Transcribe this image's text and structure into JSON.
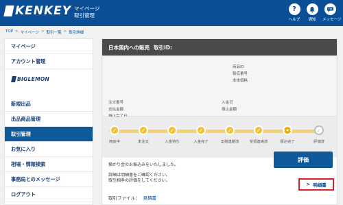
{
  "header": {
    "brand": "KENKEY",
    "subtitle_1": "マイページ",
    "subtitle_2": "取引管理",
    "icons": [
      {
        "name": "help-icon",
        "glyph": "?",
        "label": "ヘルプ"
      },
      {
        "name": "bell-icon",
        "glyph": "🔔",
        "label": "通知"
      },
      {
        "name": "chat-icon",
        "glyph": "💬",
        "label": "メッセージ"
      }
    ]
  },
  "breadcrumb": [
    "TOP",
    "マイページ",
    "取引一覧",
    "取引詳細"
  ],
  "sidebar": {
    "items": [
      {
        "label": "マイページ"
      },
      {
        "label": "アカウント管理"
      },
      {
        "label": "新規出品"
      },
      {
        "label": "出品商品管理"
      },
      {
        "label": "取引管理"
      },
      {
        "label": "お気に入り"
      },
      {
        "label": "相場・情報検索"
      },
      {
        "label": "事務局とのメッセージ"
      },
      {
        "label": "ログアウト"
      }
    ],
    "banner": "BIGLEMON"
  },
  "main": {
    "title": "日本国内への販売",
    "trade_id_label": "取引ID:",
    "info": {
      "product_id": "商品ID",
      "manufacturer_no": "製造番号",
      "body_price": "本体価格",
      "order_no": "注文番号",
      "payment_amount": "支払金額",
      "completion_date": "振込完了日",
      "deposit_date": "入金日",
      "transfer_amount": "振込金額"
    },
    "steps": [
      {
        "label": "商談中",
        "state": "done"
      },
      {
        "label": "未注文",
        "state": "done"
      },
      {
        "label": "入金待ち",
        "state": "done"
      },
      {
        "label": "入金完了",
        "state": "done"
      },
      {
        "label": "出荷連絡済",
        "state": "done"
      },
      {
        "label": "受領連絡済",
        "state": "done"
      },
      {
        "label": "振込完了",
        "state": "current"
      },
      {
        "label": "評価済",
        "state": "pending"
      }
    ],
    "message_1": "預かり金のお振込みをいたしました。",
    "message_2": "詳細は明細書をご確認ください。",
    "message_3": "取引相手の評価をしてください。",
    "evaluate_button": "評価",
    "detail_button": "明細書",
    "file_label": "取引ファイル：",
    "file_link": "見積書"
  },
  "colors": {
    "header": "#0a4f96",
    "active_menu": "#0f5a9a",
    "progress_done": "#f2c02f",
    "highlight_border": "#d9202b"
  }
}
